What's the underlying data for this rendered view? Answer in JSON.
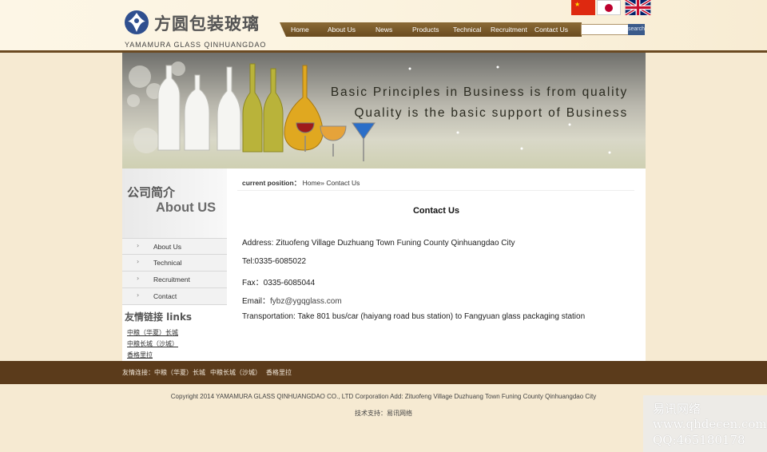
{
  "header": {
    "logo_cn": "方圆包装玻璃",
    "logo_en": "YAMAMURA GLASS QINHUANGDAO",
    "languages": [
      {
        "name": "chinese",
        "icon": "china-flag-icon"
      },
      {
        "name": "japanese",
        "icon": "japan-flag-icon"
      },
      {
        "name": "english",
        "icon": "uk-flag-icon"
      }
    ]
  },
  "nav": {
    "items": [
      "Home",
      "About Us",
      "News",
      "Products",
      "Technical",
      "Recruitment",
      "Contact Us"
    ],
    "search_button": "search"
  },
  "banner": {
    "line1": "Basic Principles in Business is from quality",
    "line2": "Quality is the basic support of Business"
  },
  "sidebar": {
    "title_cn": "公司简介",
    "title_en": "About US",
    "menu": [
      "About Us",
      "Technical",
      "Recruitment",
      "Contact"
    ],
    "links_title": "友情链接  links",
    "links": [
      "中粮（华夏）长城",
      "中粮长城（沙城）",
      "香格里拉"
    ]
  },
  "main": {
    "crumb_label": "current position：",
    "crumb_path": "Home» Contact Us",
    "title": "Contact Us",
    "address": "Address: Zituofeng Village Duzhuang Town Funing County Qinhuangdao City",
    "tel": "Tel:0335-6085022",
    "fax": "Fax：0335-6085044",
    "email_label": "Email：",
    "email": "fybz@ygqglass.com",
    "transport": "Transportation: Take 801 bus/car (haiyang road bus station) to Fangyuan glass packaging station"
  },
  "footer": {
    "links_label": "友情连接：",
    "links": [
      "中粮（华夏）长城",
      "中粮长城（沙城）",
      "香格里拉"
    ],
    "copyright": "Copyright 2014 YAMAMURA GLASS QINHUANGDAO CO., LTD Corporation Add: Zituofeng Village Duzhuang Town Funing County Qinhuangdao City",
    "tech": "技术支持：易讯网络"
  },
  "watermark": {
    "line1": "易讯网络",
    "line2": "www.qhdecen.com",
    "line3": "QQ:465180178"
  },
  "colors": {
    "brown": "#6b4a22",
    "footer_brown": "#5b3b1b",
    "page_bg": "#f6ead2"
  }
}
